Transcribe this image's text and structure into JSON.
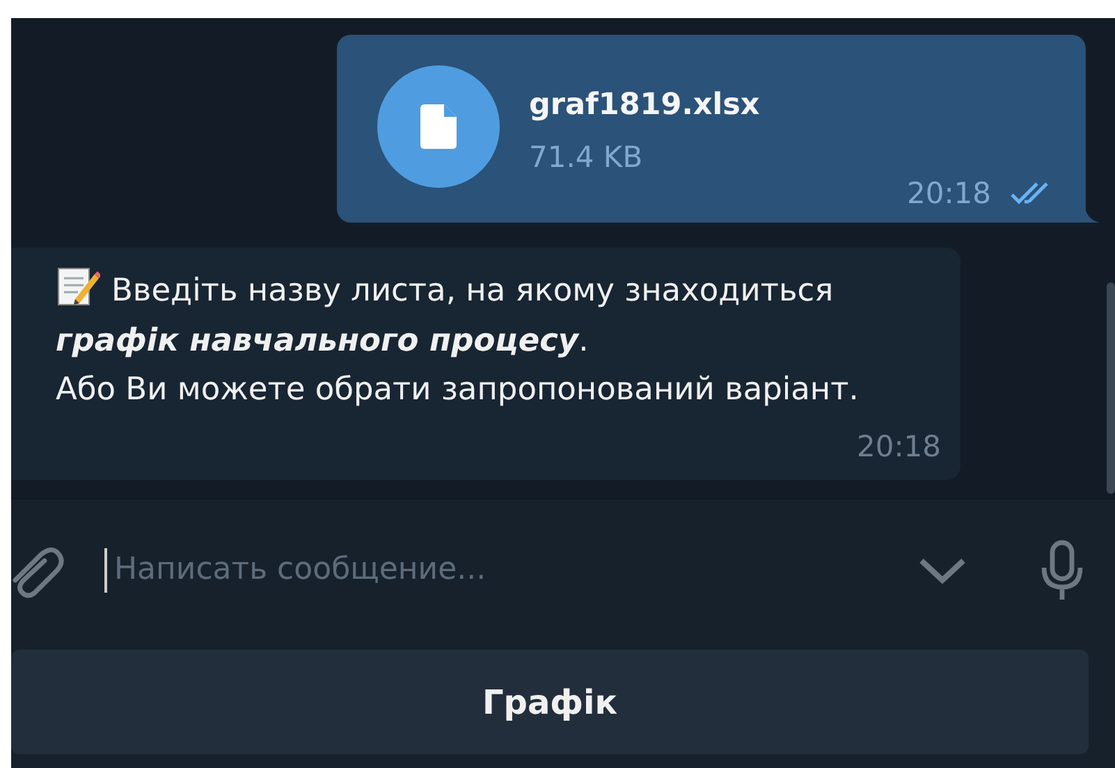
{
  "messages": [
    {
      "kind": "file",
      "outgoing": true,
      "file_name": "graf1819.xlsx",
      "file_size": "71.4 KB",
      "time": "20:18",
      "read": true
    },
    {
      "kind": "text",
      "outgoing": false,
      "text": "Введіть назву листа, на якому знаходиться\n**графік навчального процесу**.\nАбо Ви можете обрати запропонований варіант.",
      "time": "20:18"
    }
  ],
  "composer": {
    "placeholder": "Написать сообщение..."
  },
  "keyboard_buttons": [
    "Графік"
  ]
}
